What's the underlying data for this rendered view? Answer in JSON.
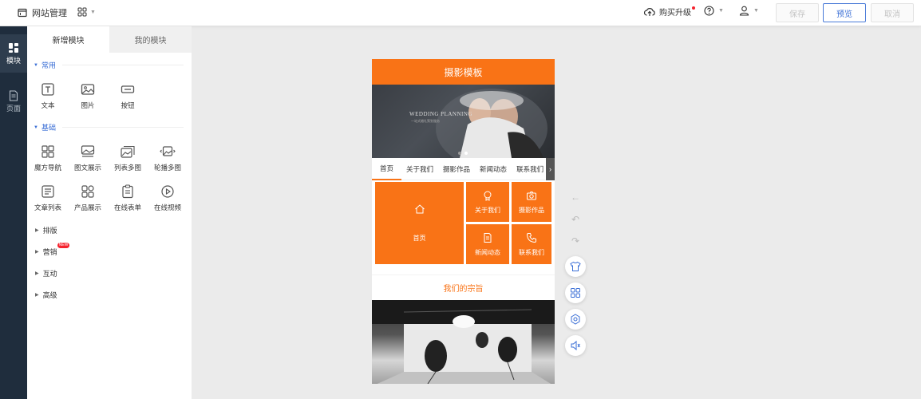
{
  "topbar": {
    "site_manage": "网站管理",
    "buy_upgrade": "购买升级",
    "save": "保存",
    "preview": "预览",
    "cancel": "取消"
  },
  "rail": {
    "modules": "模块",
    "pages": "页面"
  },
  "panel": {
    "tabs": [
      "新增模块",
      "我的模块"
    ],
    "sections": {
      "common": "常用",
      "basic": "基础"
    },
    "common_items": [
      "文本",
      "图片",
      "按钮"
    ],
    "basic_items_row1": [
      "魔方导航",
      "图文展示",
      "列表多图",
      "轮播多图"
    ],
    "basic_items_row2": [
      "文章列表",
      "产品展示",
      "在线表单",
      "在线视频"
    ],
    "collapsed": [
      "排版",
      "营销",
      "互动",
      "高级"
    ],
    "new_badge": "NEW"
  },
  "phone": {
    "title": "摄影模板",
    "banner_title": "WEDDING PLANNING",
    "banner_sub": "一站式婚礼策划服务",
    "nav": [
      "首页",
      "关于我们",
      "摄影作品",
      "新闻动态",
      "联系我们"
    ],
    "tiles": {
      "home": "首页",
      "about": "关于我们",
      "works": "摄影作品",
      "news": "新闻动态",
      "contact": "联系我们"
    },
    "mission": "我们的宗旨"
  },
  "colors": {
    "accent": "#f97316",
    "primary": "#3b6fd6",
    "rail": "#1f2d3d"
  }
}
